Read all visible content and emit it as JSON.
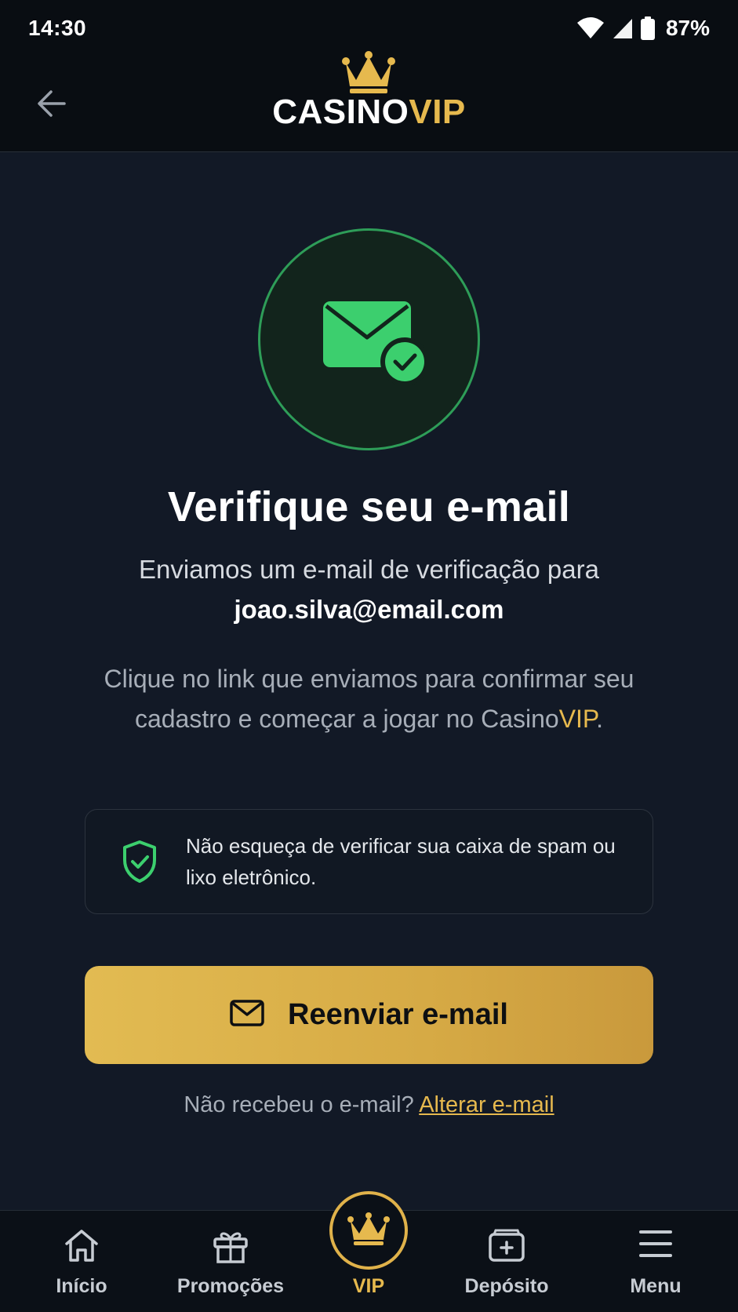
{
  "status_bar": {
    "time": "14:30",
    "battery": "87%",
    "icons": [
      "wifi-icon",
      "signal-icon",
      "battery-icon"
    ]
  },
  "app_bar": {
    "back_icon": "arrow-left-icon",
    "logo": {
      "part1": "CASINO",
      "part2": "VIP",
      "icon": "crown-icon"
    }
  },
  "hero": {
    "icon": "envelope-check-icon"
  },
  "content": {
    "title": "Verifique seu e-mail",
    "sent_line": "Enviamos um e-mail de verificação para",
    "email": "joao.silva@email.com",
    "instructions_pre": "Clique no link que enviamos para confirmar seu cadastro e começar a jogar no Casino",
    "instructions_vip": "VIP",
    "instructions_post": "."
  },
  "spam_notice": {
    "icon": "shield-check-icon",
    "text": "Não esqueça de verificar sua caixa de spam ou lixo eletrônico."
  },
  "resend_button": {
    "label": "Reenviar e-mail",
    "icon": "mail-icon"
  },
  "change_email": {
    "prompt": "Não recebeu o e-mail?",
    "link": "Alterar e-mail"
  },
  "bottom_nav": {
    "items": [
      {
        "label": "Início",
        "icon": "home-icon"
      },
      {
        "label": "Promoções",
        "icon": "gift-icon"
      },
      {
        "label": "VIP",
        "icon": "crown-icon",
        "active": true
      },
      {
        "label": "Depósito",
        "icon": "wallet-icon"
      },
      {
        "label": "Menu",
        "icon": "menu-icon"
      }
    ]
  },
  "colors": {
    "accent_gold": "#e6b94e",
    "success_green": "#3ccf6e",
    "background": "#121926"
  }
}
